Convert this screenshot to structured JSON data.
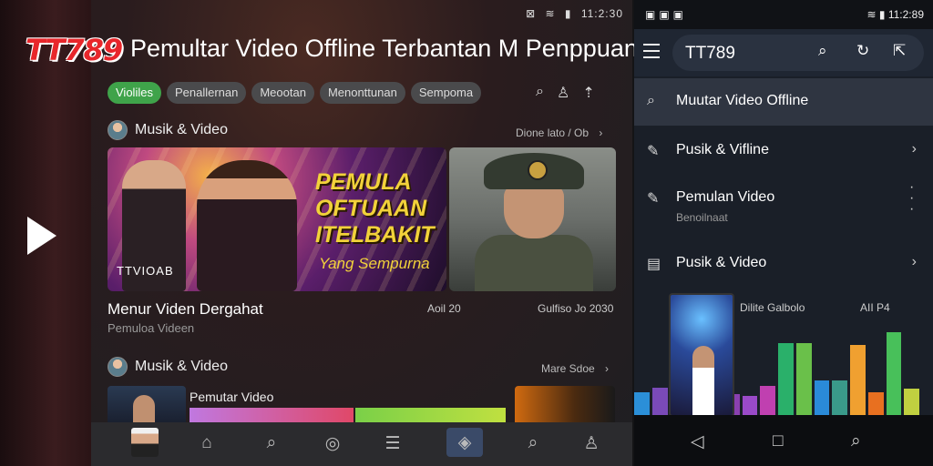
{
  "main": {
    "brand": "TT789",
    "headline": "Pemultar Video Offline Terbantan M Penppuan",
    "status_time": "11:2:30",
    "chips": [
      "Violiles",
      "Penallernan",
      "Meootan",
      "Menonttunan",
      "Sempoma"
    ],
    "sections": [
      {
        "title": "Musik & Video",
        "more": "Dione lato / Ob"
      },
      {
        "title": "Musik & Video",
        "more": "Mare Sdoe"
      }
    ],
    "featured": {
      "poster_line1": "PEMULA",
      "poster_line2": "OFTUAAN",
      "poster_line3": "ITELBAKIT",
      "poster_tag": "Yang Sempurna",
      "poster_logo": "TTVIOAB",
      "title": "Menur Viden Dergahat",
      "subtitle": "Pemuloa Videen",
      "meta_left": "Aoil 20",
      "meta_right": "Gulfiso Jo 2030"
    },
    "strip_label": "Pemutar Video"
  },
  "phone": {
    "status_time": "11:2:89",
    "search_text": "TT789",
    "menu": [
      {
        "label": "Muutar Video Offline",
        "sub": "",
        "selected": true
      },
      {
        "label": "Pusik & Vifline",
        "sub": ""
      },
      {
        "label": "Pemulan Video",
        "sub": "Benoilnaat"
      },
      {
        "label": "Pusik & Video",
        "sub": ""
      }
    ],
    "viz_label_left": "Dilite Galbolo",
    "viz_label_right": "AII P4",
    "bars": [
      {
        "color": "#2b8fd8",
        "level": 0.26
      },
      {
        "color": "#7a4ab8",
        "level": 0.31
      },
      {
        "color": "#3a6ad8",
        "level": 0.62
      },
      {
        "color": "#2a5ac8",
        "level": 0.4
      },
      {
        "color": "#8a4ac8",
        "level": 0.58
      },
      {
        "color": "#8a40b0",
        "level": 0.24
      },
      {
        "color": "#9a4ac8",
        "level": 0.22
      },
      {
        "color": "#c040b0",
        "level": 0.33
      },
      {
        "color": "#2ab06a",
        "level": 0.82
      },
      {
        "color": "#6ac04a",
        "level": 0.82
      },
      {
        "color": "#2a8ad8",
        "level": 0.4
      },
      {
        "color": "#3a9a8a",
        "level": 0.4
      },
      {
        "color": "#f0a030",
        "level": 0.8
      },
      {
        "color": "#e87020",
        "level": 0.26
      },
      {
        "color": "#48c05a",
        "level": 0.95
      },
      {
        "color": "#c0d040",
        "level": 0.3
      }
    ]
  }
}
